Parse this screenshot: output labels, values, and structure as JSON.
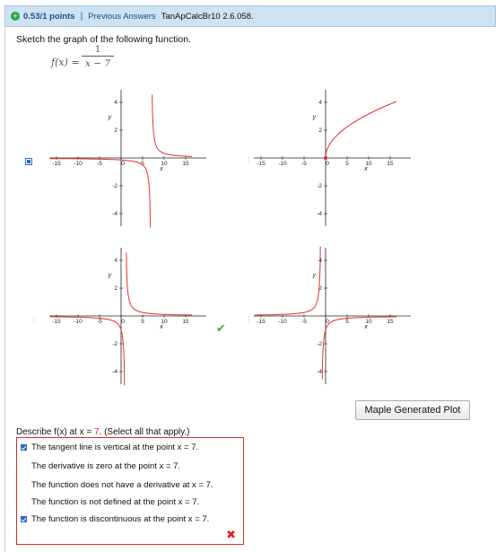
{
  "header": {
    "points": "0.53/1 points",
    "separator": "|",
    "previous_answers": "Previous Answers",
    "problem_code": "TanApCalcBr10 2.6.058."
  },
  "question": {
    "prompt": "Sketch the graph of the following function.",
    "formula_lhs": "f(x) =",
    "formula_numerator": "1",
    "formula_denominator": "x − 7"
  },
  "graphs": {
    "x_axis_label": "x",
    "y_axis_label": "y",
    "x_ticks": [
      "-15",
      "-10",
      "-5",
      "0",
      "5",
      "10",
      "15"
    ],
    "y_ticks": [
      "4",
      "2",
      "-2",
      "-4"
    ],
    "options": [
      {
        "name": "top-left",
        "selected": true,
        "correct_mark": false,
        "curve": "1/(x-7)"
      },
      {
        "name": "top-right",
        "selected": false,
        "correct_mark": false,
        "curve": "sqrt(x)"
      },
      {
        "name": "bottom-left",
        "selected": false,
        "correct_mark": true,
        "curve": "1/(x-1)"
      },
      {
        "name": "bottom-right",
        "selected": false,
        "correct_mark": false,
        "curve": "-1/(x+1)"
      }
    ],
    "curve_color": "#e03535",
    "checkmark_glyph": "✔"
  },
  "maple_button": "Maple Generated Plot",
  "describe": {
    "prefix": "Describe f(x) at x = ",
    "value": "7",
    "suffix": ". (Select all that apply.)"
  },
  "choices": [
    {
      "label": "The tangent line is vertical at the point x = 7.",
      "checked": true
    },
    {
      "label": "The derivative is zero at the point x = 7.",
      "checked": false
    },
    {
      "label": "The function does not have a derivative at x = 7.",
      "checked": false
    },
    {
      "label": "The function is not defined at the point x = 7.",
      "checked": false
    },
    {
      "label": "The function is discontinuous at the point x = 7.",
      "checked": true
    }
  ],
  "incorrect_glyph": "✖",
  "colors": {
    "accent": "#2b6cb8",
    "error": "#c9302c",
    "correct": "#49a84a",
    "header_bg": "#cde2f2"
  }
}
